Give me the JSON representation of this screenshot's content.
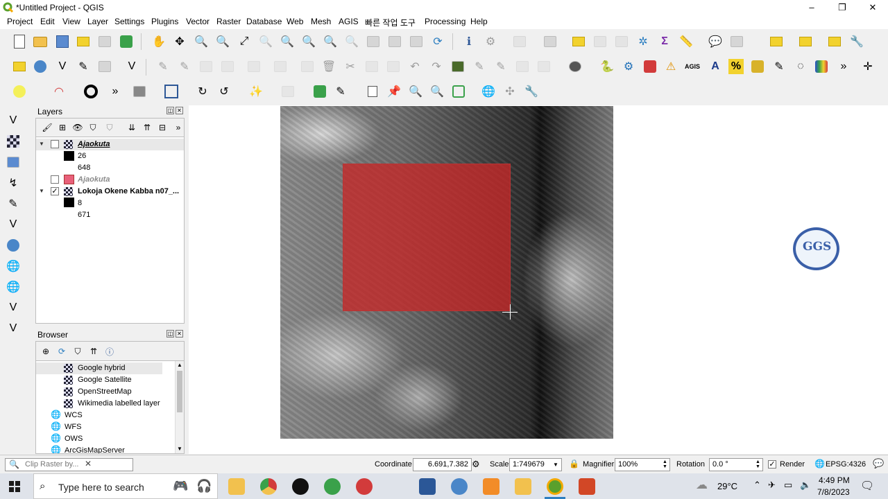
{
  "window": {
    "title": "*Untitled Project - QGIS",
    "minimize": "–",
    "restore": "❐",
    "close": "✕"
  },
  "menu": [
    "Project",
    "Edit",
    "View",
    "Layer",
    "Settings",
    "Plugins",
    "Vector",
    "Raster",
    "Database",
    "Web",
    "Mesh",
    "AGIS",
    "빠른 작업 도구",
    "Processing",
    "Help"
  ],
  "layers_panel": {
    "title": "Layers",
    "items": [
      {
        "name": "Ajaokuta",
        "checked": false,
        "min": "26",
        "max": "648"
      },
      {
        "name": "Ajaokuta",
        "checked": false,
        "color": "#e8607a"
      },
      {
        "name": "Lokoja Okene Kabba n07_...",
        "checked": true,
        "min": "8",
        "max": "671"
      }
    ]
  },
  "browser_panel": {
    "title": "Browser",
    "items": [
      "Google hybrid",
      "Google Satellite",
      "OpenStreetMap",
      "Wikimedia labelled layer",
      "WCS",
      "WFS",
      "OWS",
      "ArcGisMapServer"
    ]
  },
  "locator": {
    "placeholder": "Clip Raster by..."
  },
  "statusbar": {
    "coordinate_label": "Coordinate",
    "coordinate_value": "6.691,7.382",
    "scale_label": "Scale",
    "scale_value": "1:749679",
    "magnifier_label": "Magnifier",
    "magnifier_value": "100%",
    "rotation_label": "Rotation",
    "rotation_value": "0.0 °",
    "render_label": "Render",
    "crs": "EPSG:4326"
  },
  "logo_text": "GGS",
  "taskbar": {
    "search_placeholder": "Type here to search",
    "weather": "29°C",
    "time": "4:49 PM",
    "date": "7/8/2023"
  },
  "colors": {
    "selection_overlay": "#c62828",
    "layer_swatch": "#e8607a",
    "accent": "#3a5fa8"
  }
}
